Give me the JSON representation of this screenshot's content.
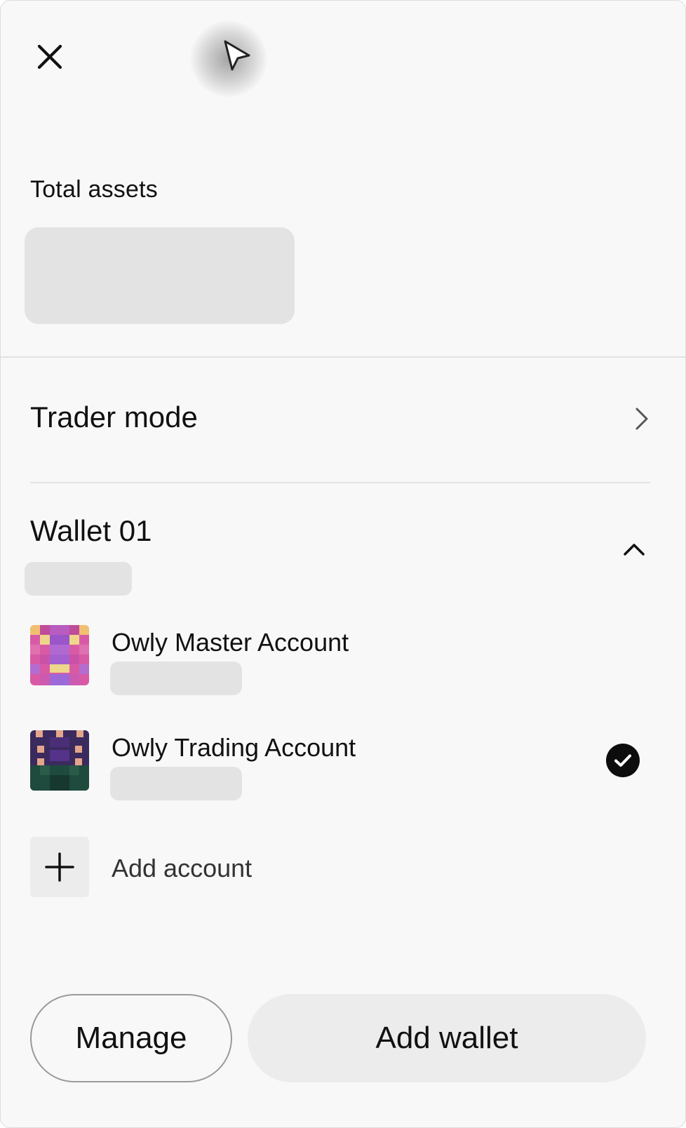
{
  "header": {
    "close_icon": "close-icon",
    "cursor_icon": "pointer-cursor-icon"
  },
  "total_assets": {
    "label": "Total assets"
  },
  "trader_mode": {
    "label": "Trader mode",
    "icon": "chevron-right-icon"
  },
  "wallet": {
    "title": "Wallet 01",
    "expanded_icon": "chevron-up-icon",
    "accounts": [
      {
        "name": "Owly Master Account",
        "selected": false
      },
      {
        "name": "Owly Trading Account",
        "selected": true
      }
    ],
    "add_account_label": "Add account"
  },
  "footer": {
    "manage_label": "Manage",
    "add_wallet_label": "Add wallet"
  }
}
